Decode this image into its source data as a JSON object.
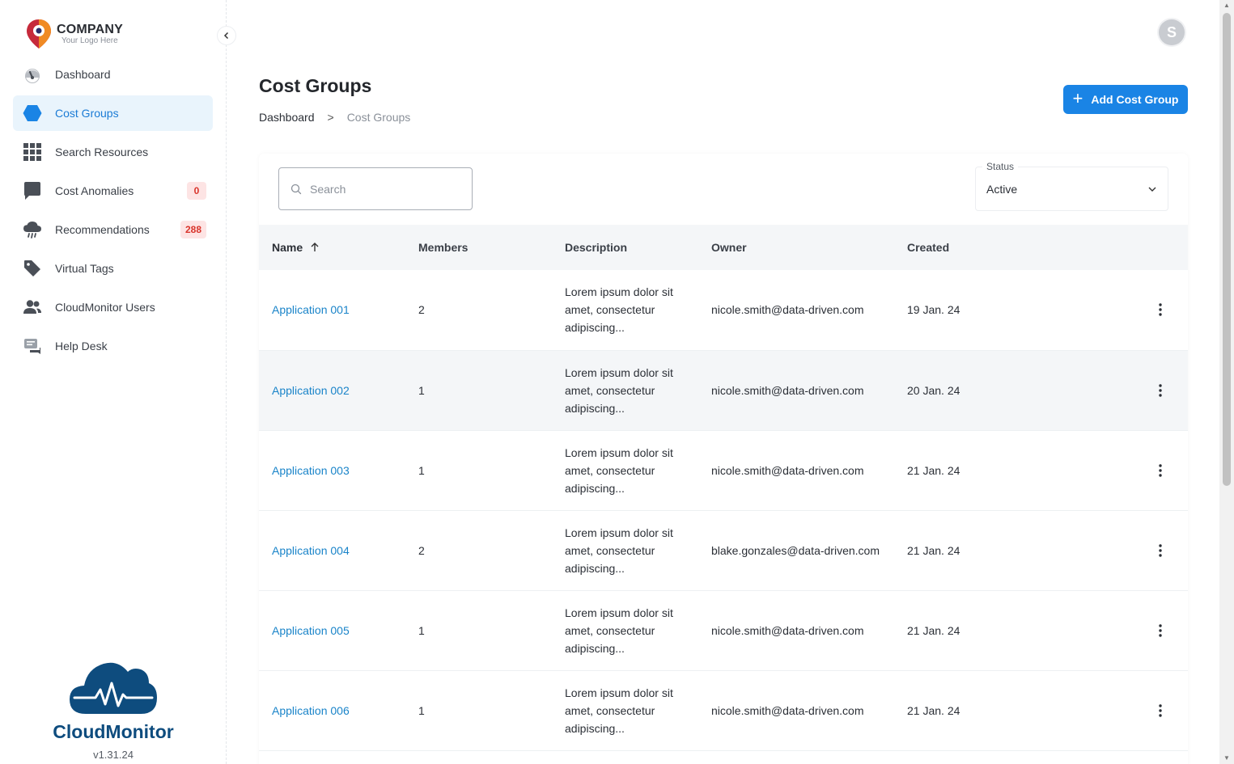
{
  "company": {
    "name": "COMPANY",
    "tagline": "Your Logo Here"
  },
  "sidebar": {
    "items": [
      {
        "label": "Dashboard",
        "icon": "gauge-icon",
        "active": false,
        "badge": null
      },
      {
        "label": "Cost Groups",
        "icon": "hexagon-icon",
        "active": true,
        "badge": null
      },
      {
        "label": "Search Resources",
        "icon": "grid-icon",
        "active": false,
        "badge": null
      },
      {
        "label": "Cost Anomalies",
        "icon": "chat-icon",
        "active": false,
        "badge": "0"
      },
      {
        "label": "Recommendations",
        "icon": "cloud-rain-icon",
        "active": false,
        "badge": "288"
      },
      {
        "label": "Virtual Tags",
        "icon": "tag-icon",
        "active": false,
        "badge": null
      },
      {
        "label": "CloudMonitor Users",
        "icon": "users-icon",
        "active": false,
        "badge": null
      },
      {
        "label": "Help Desk",
        "icon": "help-desk-icon",
        "active": false,
        "badge": null
      }
    ],
    "brand_name": "CloudMonitor",
    "version": "v1.31.24"
  },
  "header": {
    "avatar_initial": "S"
  },
  "page": {
    "title": "Cost Groups",
    "breadcrumb": [
      "Dashboard",
      ">",
      "Cost Groups"
    ],
    "add_button_label": "Add Cost Group"
  },
  "filters": {
    "search_placeholder": "Search",
    "status_label": "Status",
    "status_value": "Active"
  },
  "table": {
    "columns": [
      "Name",
      "Members",
      "Description",
      "Owner",
      "Created"
    ],
    "sorted_column": "Name",
    "sort_direction": "ascending",
    "rows": [
      {
        "name": "Application 001",
        "members": "2",
        "description": "Lorem ipsum dolor sit amet, consectetur adipiscing...",
        "owner": "nicole.smith@data-driven.com",
        "created": "19 Jan. 24"
      },
      {
        "name": "Application 002",
        "members": "1",
        "description": "Lorem ipsum dolor sit amet, consectetur adipiscing...",
        "owner": "nicole.smith@data-driven.com",
        "created": "20 Jan. 24"
      },
      {
        "name": "Application 003",
        "members": "1",
        "description": "Lorem ipsum dolor sit amet, consectetur adipiscing...",
        "owner": "nicole.smith@data-driven.com",
        "created": "21 Jan. 24"
      },
      {
        "name": "Application 004",
        "members": "2",
        "description": "Lorem ipsum dolor sit amet, consectetur adipiscing...",
        "owner": "blake.gonzales@data-driven.com",
        "created": "21 Jan. 24"
      },
      {
        "name": "Application 005",
        "members": "1",
        "description": "Lorem ipsum dolor sit amet, consectetur adipiscing...",
        "owner": "nicole.smith@data-driven.com",
        "created": "21 Jan. 24"
      },
      {
        "name": "Application 006",
        "members": "1",
        "description": "Lorem ipsum dolor sit amet, consectetur adipiscing...",
        "owner": "nicole.smith@data-driven.com",
        "created": "21 Jan. 24"
      }
    ]
  },
  "colors": {
    "accent": "#1a84e5",
    "link": "#1a84c9",
    "active_nav_bg": "#e9f4fc",
    "badge_bg": "#fde4e4",
    "badge_text": "#d9342b",
    "brand": "#0e4c7e"
  }
}
